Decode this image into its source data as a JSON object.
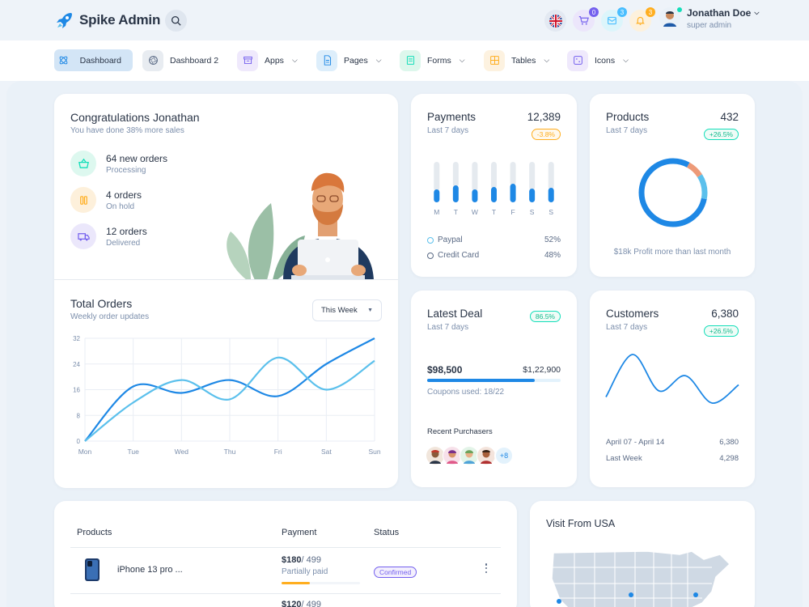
{
  "app": {
    "name": "Spike Admin"
  },
  "header": {
    "cart_badge": "0",
    "mail_badge": "3",
    "bell_badge": "3",
    "user_name": "Jonathan Doe",
    "user_role": "super admin"
  },
  "nav": {
    "dashboard": "Dashboard",
    "dashboard2": "Dashboard 2",
    "apps": "Apps",
    "pages": "Pages",
    "forms": "Forms",
    "tables": "Tables",
    "icons": "Icons"
  },
  "welcome": {
    "title": "Congratulations Jonathan",
    "subtitle": "You have done 38% more sales",
    "stats": [
      {
        "title": "64 new orders",
        "sub": "Processing"
      },
      {
        "title": "4 orders",
        "sub": "On hold"
      },
      {
        "title": "12 orders",
        "sub": "Delivered"
      }
    ]
  },
  "total_orders": {
    "title": "Total Orders",
    "subtitle": "Weekly order updates",
    "select": "This Week"
  },
  "payments": {
    "title": "Payments",
    "subtitle": "Last 7 days",
    "value": "12,389",
    "change": "-3.8%",
    "legend": [
      {
        "label": "Paypal",
        "value": "52%"
      },
      {
        "label": "Credit Card",
        "value": "48%"
      }
    ]
  },
  "products_card": {
    "title": "Products",
    "subtitle": "Last 7 days",
    "value": "432",
    "change": "+26.5%",
    "footer": "$18k Profit more than last month"
  },
  "deal": {
    "title": "Latest Deal",
    "subtitle": "Last 7 days",
    "badge": "86.5%",
    "amount": "$98,500",
    "target": "$1,22,900",
    "coupons": "Coupons used: 18/22",
    "purchasers_label": "Recent Purchasers",
    "more": "+8",
    "progress": 0.805
  },
  "customers": {
    "title": "Customers",
    "subtitle": "Last 7 days",
    "value": "6,380",
    "change": "+26.5%",
    "range_label": "April 07 - April 14",
    "range_value": "6,380",
    "last_label": "Last Week",
    "last_value": "4,298"
  },
  "products_table": {
    "col1": "Products",
    "col2": "Payment",
    "col3": "Status",
    "rows": [
      {
        "name": "iPhone 13 pro ...",
        "paid": "$180",
        "total": "/ 499",
        "note": "Partially paid",
        "status": "Confirmed",
        "progress": 0.36
      },
      {
        "paid": "$120",
        "total": "/ 499"
      }
    ]
  },
  "visit": {
    "title": "Visit From USA"
  },
  "colors": {
    "primary": "#1e88e5",
    "secondary": "#5bc0ec",
    "success": "#13deb9",
    "warning": "#ffae1f",
    "purple": "#7460ee"
  },
  "chart_data": [
    {
      "type": "line",
      "categories": [
        "Mon",
        "Tue",
        "Wed",
        "Thu",
        "Fri",
        "Sat",
        "Sun"
      ],
      "y_ticks": [
        0,
        8,
        16,
        24,
        32
      ],
      "ylim": [
        0,
        32
      ],
      "series": [
        {
          "values": [
            0,
            17,
            15,
            19,
            14,
            24,
            32
          ]
        },
        {
          "values": [
            0,
            12,
            19,
            13,
            26,
            16,
            25
          ]
        }
      ]
    },
    {
      "type": "bar",
      "categories": [
        "M",
        "T",
        "W",
        "T",
        "F",
        "S",
        "S"
      ],
      "series": [
        {
          "values": [
            28,
            38,
            28,
            34,
            42,
            30,
            32
          ]
        },
        {
          "values": [
            72,
            62,
            72,
            66,
            58,
            70,
            68
          ]
        }
      ]
    },
    {
      "type": "pie",
      "series": [
        {
          "values": [
            80
          ]
        },
        {
          "values": [
            8
          ]
        },
        {
          "values": [
            12
          ]
        }
      ]
    },
    {
      "type": "line",
      "series": [
        {
          "values": [
            4,
            11,
            5,
            7.5,
            3,
            6
          ]
        }
      ]
    }
  ]
}
